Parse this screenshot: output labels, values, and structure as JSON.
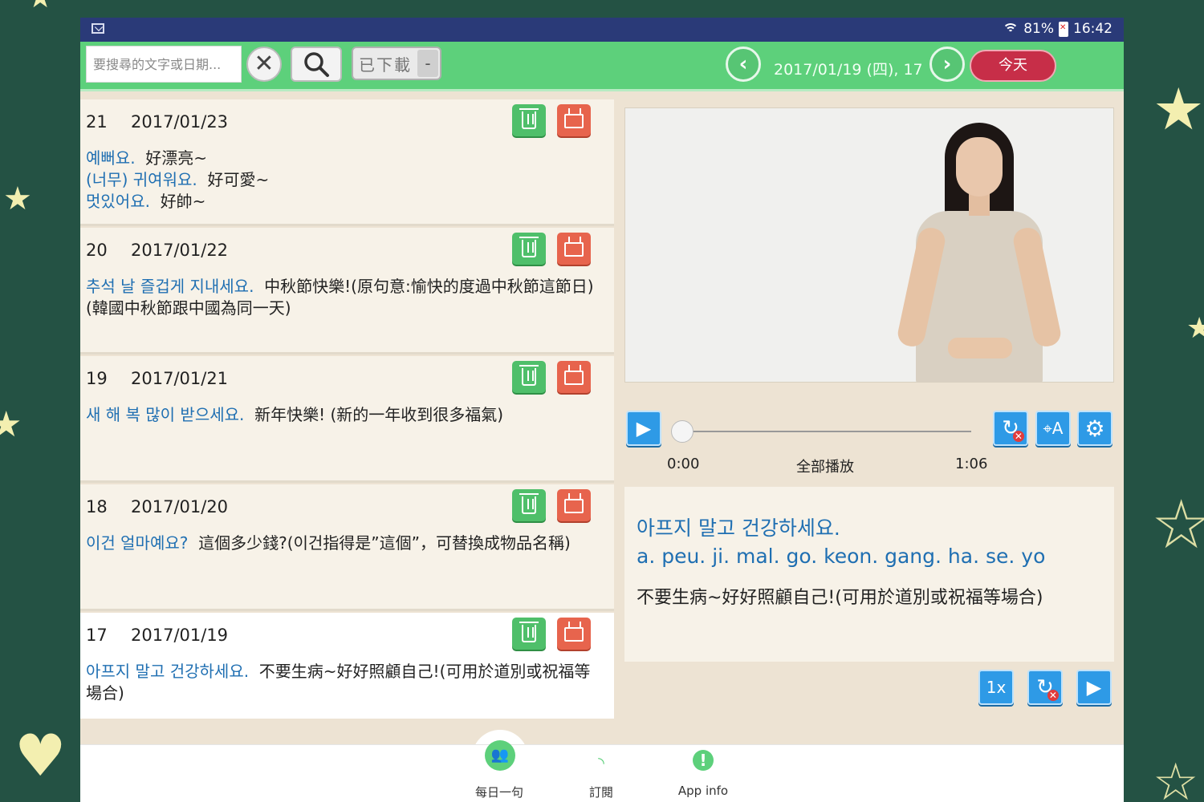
{
  "status_bar": {
    "battery": "81%",
    "time": "16:42"
  },
  "toolbar": {
    "search_placeholder": "要搜尋的文字或日期...",
    "downloaded_label": "已下載",
    "downloaded_minus": "-",
    "date_label": "2017/01/19 (四), 17",
    "today_label": "今天"
  },
  "entries": [
    {
      "num": "21",
      "date": "2017/01/23",
      "lines": [
        {
          "ko": "예뻐요.",
          "zh": "好漂亮~"
        },
        {
          "ko": "(너무) 귀여워요.",
          "zh": "好可愛~"
        },
        {
          "ko": "멋있어요.",
          "zh": "好帥~"
        }
      ]
    },
    {
      "num": "20",
      "date": "2017/01/22",
      "lines": [
        {
          "ko": "추석 날 즐겁게 지내세요.",
          "zh": "中秋節快樂!(原句意:愉快的度過中秋節這節日)(韓國中秋節跟中國為同一天)"
        }
      ]
    },
    {
      "num": "19",
      "date": "2017/01/21",
      "lines": [
        {
          "ko": "새 해 복 많이 받으세요.",
          "zh": "新年快樂!  (新的一年收到很多福氣)"
        }
      ]
    },
    {
      "num": "18",
      "date": "2017/01/20",
      "lines": [
        {
          "ko": "이건 얼마예요?",
          "zh": "這個多少錢?(이건指得是”這個”，可替換成物品名稱)"
        }
      ]
    },
    {
      "num": "17",
      "date": "2017/01/19",
      "lines": [
        {
          "ko": "아프지 말고 건강하세요.",
          "zh": "不要生病~好好照顧自己!(可用於道別或祝福等場合)"
        }
      ]
    }
  ],
  "player": {
    "current_time": "0:00",
    "mode_label": "全部播放",
    "total_time": "1:06",
    "speed_label": "1x",
    "progress": 0
  },
  "sentence": {
    "korean": "아프지 말고 건강하세요.",
    "romanization": "a. peu. ji. mal. go. keon. gang. ha. se. yo",
    "chinese": "不要生病~好好照顧自己!(可用於道別或祝福等場合)"
  },
  "bottom_nav": [
    {
      "label": "每日一句",
      "icon": "people-icon"
    },
    {
      "label": "訂閱",
      "icon": "rss-icon"
    },
    {
      "label": "App info",
      "icon": "info-icon"
    }
  ],
  "colors": {
    "toolbar": "#5dd07b",
    "status_bar": "#2a3a78",
    "korean_text": "#1f6fb2",
    "today_button": "#c72e48",
    "background": "#245244"
  }
}
